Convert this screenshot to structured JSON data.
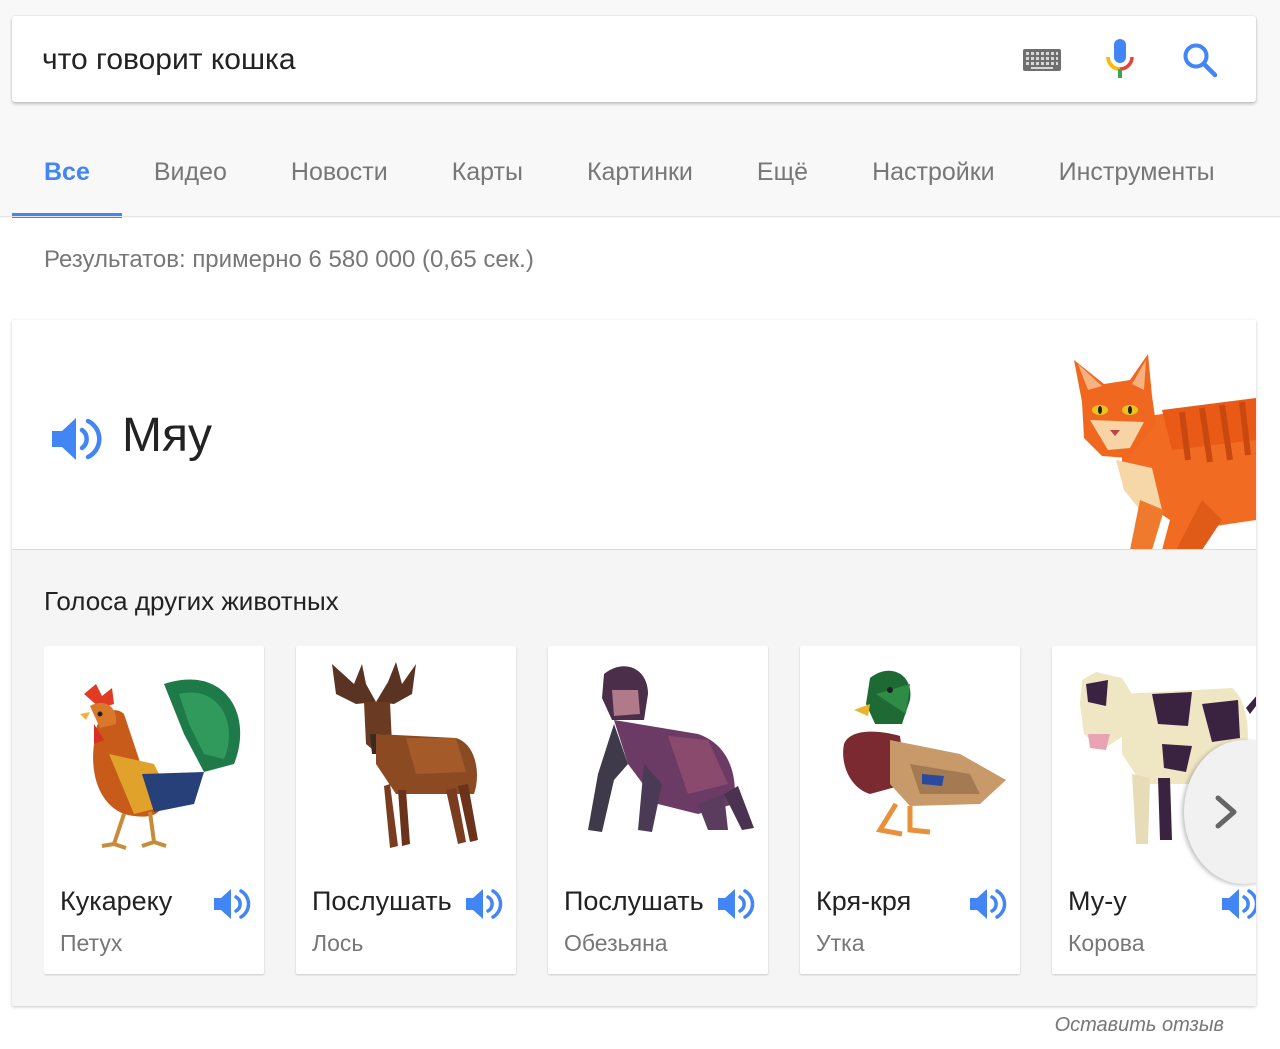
{
  "search": {
    "query": "что говорит кошка",
    "icons": [
      "keyboard-icon",
      "microphone-icon",
      "search-icon"
    ]
  },
  "tabs": [
    {
      "label": "Все",
      "active": true
    },
    {
      "label": "Видео",
      "active": false
    },
    {
      "label": "Новости",
      "active": false
    },
    {
      "label": "Карты",
      "active": false
    },
    {
      "label": "Картинки",
      "active": false
    },
    {
      "label": "Ещё",
      "active": false
    },
    {
      "label": "Настройки",
      "active": false
    },
    {
      "label": "Инструменты",
      "active": false
    }
  ],
  "stats": "Результатов: примерно 6 580 000 (0,65 сек.)",
  "answer": {
    "sound": "Мяу",
    "animal_icon": "cat-illustration"
  },
  "others": {
    "title": "Голоса других животных",
    "items": [
      {
        "sound": "Кукареку",
        "name": "Петух",
        "icon": "rooster-illustration"
      },
      {
        "sound": "Послушать",
        "name": "Лось",
        "icon": "moose-illustration"
      },
      {
        "sound": "Послушать",
        "name": "Обезьяна",
        "icon": "gorilla-illustration"
      },
      {
        "sound": "Кря-кря",
        "name": "Утка",
        "icon": "duck-illustration"
      },
      {
        "sound": "Му-у",
        "name": "Корова",
        "icon": "cow-illustration"
      }
    ]
  },
  "feedback": "Оставить отзыв",
  "colors": {
    "accent": "#4285f4",
    "mic_red": "#ea4335",
    "mic_yellow": "#fbbc05",
    "mic_green": "#34a853",
    "cat_orange": "#f26b22"
  }
}
